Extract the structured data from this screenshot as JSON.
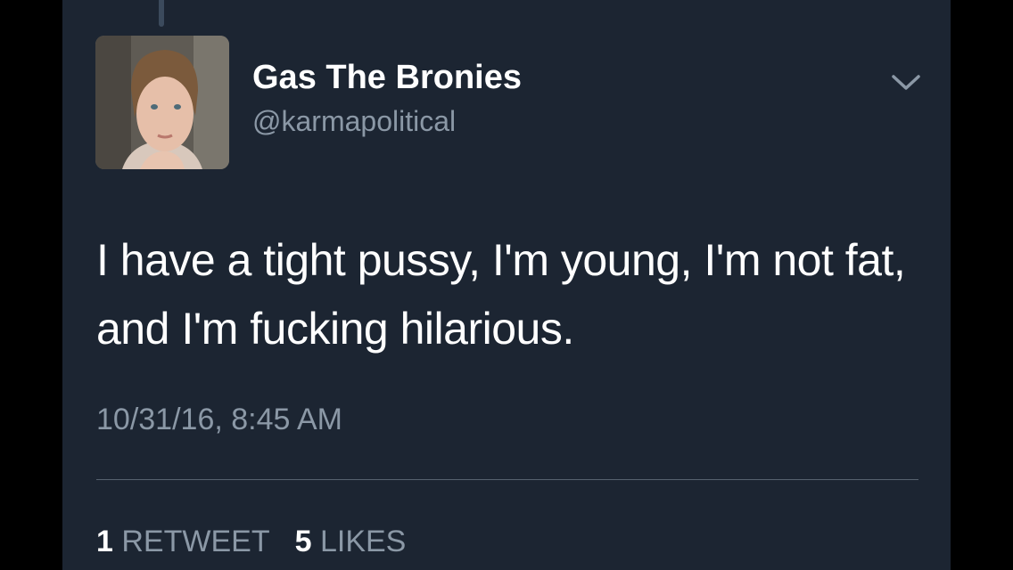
{
  "tweet": {
    "display_name": "Gas The Bronies",
    "handle": "@karmapolitical",
    "text": "I have a tight pussy, I'm young, I'm not fat, and I'm fucking hilarious.",
    "timestamp": "10/31/16, 8:45 AM",
    "retweet_count": "1",
    "retweet_label": "RETWEET",
    "like_count": "5",
    "like_label": "LIKES"
  },
  "icons": {
    "menu": "chevron-down-icon",
    "avatar": "profile-photo"
  },
  "colors": {
    "page_background": "#000000",
    "card_background": "#1c2532",
    "primary_text": "#ffffff",
    "secondary_text": "#8b98a6",
    "divider": "#56626f"
  }
}
